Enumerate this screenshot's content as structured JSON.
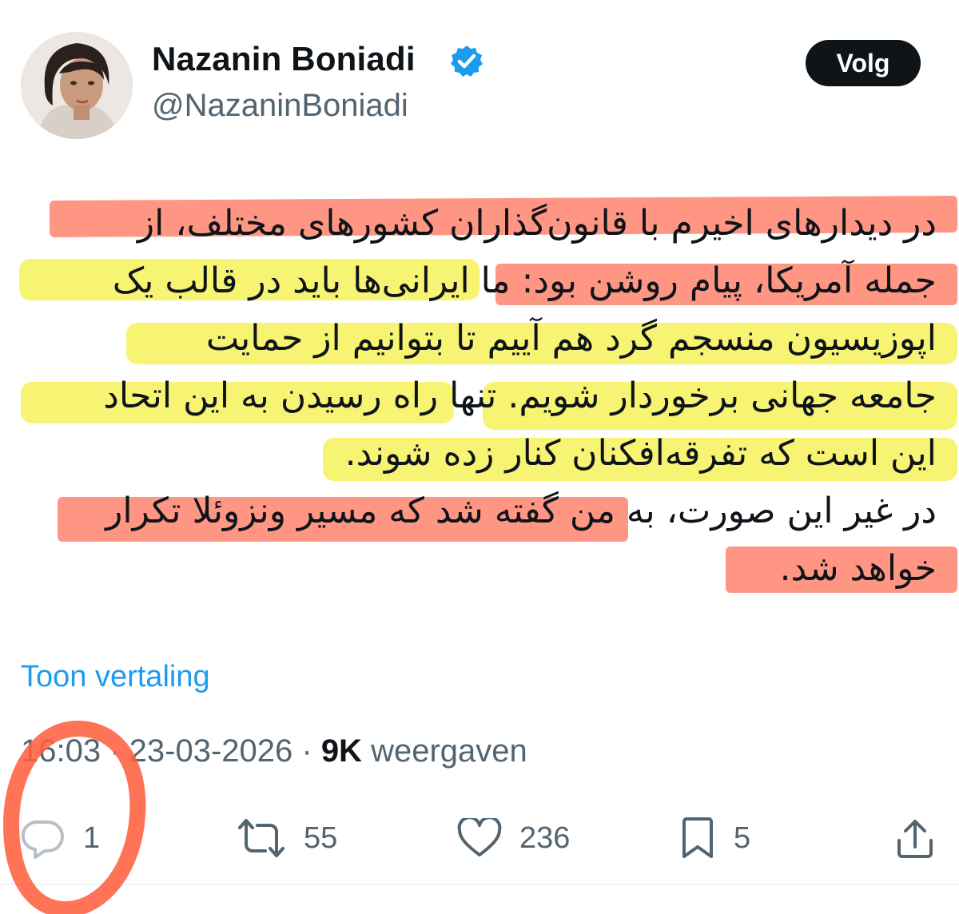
{
  "author": {
    "name": "Nazanin Boniadi",
    "handle": "@NazaninBoniadi",
    "verified_icon": "verified-badge-icon"
  },
  "follow_label": "Volg",
  "tweet_lines": [
    "در دیدارهای اخیرم با قانون‌گذاران کشورهای مختلف، از",
    "جمله آمریکا، پیام روشن بود: ما ایرانی‌ها باید در قالب یک",
    "اپوزیسیون منسجم گرد هم آییم تا بتوانیم از حمایت",
    "جامعه جهانی برخوردار شویم. تنها راه رسیدن به این اتحاد",
    "این است که تفرقه‌افکنان کنار زده شوند.",
    "در غیر این صورت، به من گفته شد که مسیر ونزوئلا تکرار",
    "خواهد شد."
  ],
  "translate_label": "Toon vertaling",
  "meta": {
    "time": "16:03",
    "separator": " · ",
    "date": "23-03-2026",
    "views_count": "9K",
    "views_label": " weergaven"
  },
  "actions": {
    "replies": "1",
    "retweets": "55",
    "likes": "236",
    "bookmarks": "5"
  },
  "colors": {
    "highlight_red": "#ff7862",
    "highlight_yellow": "#f7f25a",
    "link_blue": "#1d9bf0",
    "muted": "#536471",
    "verified_blue": "#1d9bf0"
  }
}
